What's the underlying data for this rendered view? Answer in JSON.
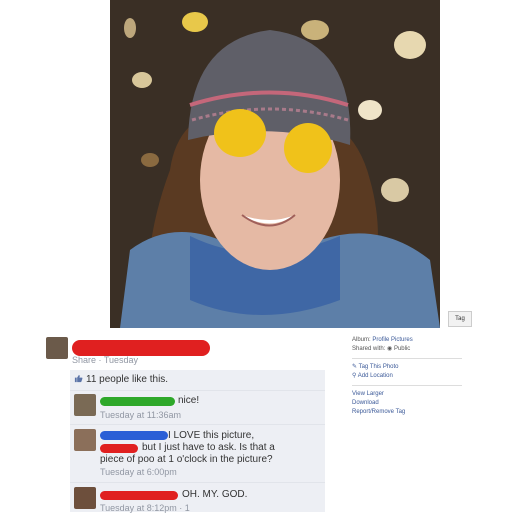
{
  "photo": {
    "tag_button_label": "Tag"
  },
  "sidebar": {
    "album_label": "Album:",
    "album_value": "Profile Pictures",
    "shared_label": "Shared with:",
    "shared_value": "Public",
    "tag_photo": "Tag This Photo",
    "add_location": "Add Location",
    "view_larger": "View Larger",
    "download": "Download",
    "report": "Report/Remove Tag"
  },
  "post": {
    "share_line": "Share · Tuesday",
    "likes": "11 people like this."
  },
  "comments": [
    {
      "line1": "nice!",
      "time": "Tuesday at 11:36am",
      "redact_color": "#2ea82a"
    },
    {
      "line1": "I LOVE this picture,",
      "line2": "but I just have to ask. Is that a",
      "line3": "piece of poo at 1 o'clock in the picture?",
      "time": "Tuesday at 6:00pm",
      "redact_color": "#2a5fd6"
    },
    {
      "line1": "OH. MY. GOD.",
      "time": "Tuesday at 8:12pm · 1",
      "redact_color": "#e02020"
    }
  ],
  "colors": {
    "redaction_red": "#e02020",
    "redaction_green": "#2ea82a",
    "redaction_blue": "#2a5fd6",
    "link_blue": "#3b5998",
    "comment_bg": "#edeff4"
  }
}
